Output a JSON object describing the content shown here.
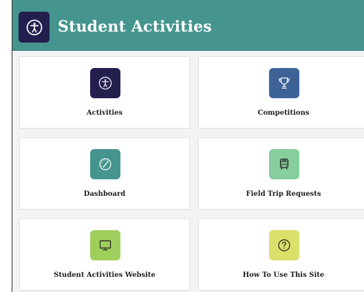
{
  "header": {
    "title": "Student Activities",
    "logo_icon": "accessibility-icon",
    "background_color": "#45958e",
    "logo_color": "#231f4f"
  },
  "tiles": [
    {
      "label": "Activities",
      "icon": "accessibility-icon",
      "color": "#231f4f"
    },
    {
      "label": "Competitions",
      "icon": "trophy-icon",
      "color": "#3d6396"
    },
    {
      "label": "Dashboard",
      "icon": "speedometer-icon",
      "color": "#45958e"
    },
    {
      "label": "Field Trip Requests",
      "icon": "bus-icon",
      "color": "#86ce9d"
    },
    {
      "label": "Student Activities Website",
      "icon": "monitor-icon",
      "color": "#9ecf5c"
    },
    {
      "label": "How To Use This Site",
      "icon": "question-icon",
      "color": "#dbe06a"
    }
  ]
}
